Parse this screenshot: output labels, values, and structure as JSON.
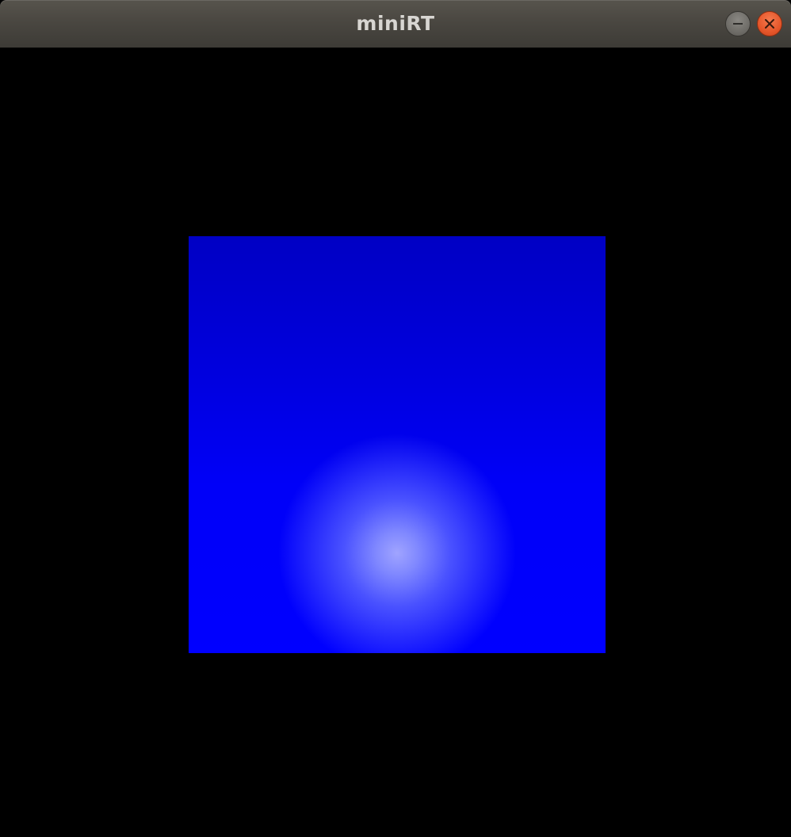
{
  "window": {
    "title": "miniRT",
    "buttons": {
      "minimize_icon": "minimize-icon",
      "close_icon": "close-icon"
    }
  },
  "render": {
    "base_color": "#0000ff",
    "highlight_color": "#a0a4ff"
  },
  "colors": {
    "titlebar": "#4a4741",
    "background": "#000000",
    "close_button": "#e5562a"
  }
}
